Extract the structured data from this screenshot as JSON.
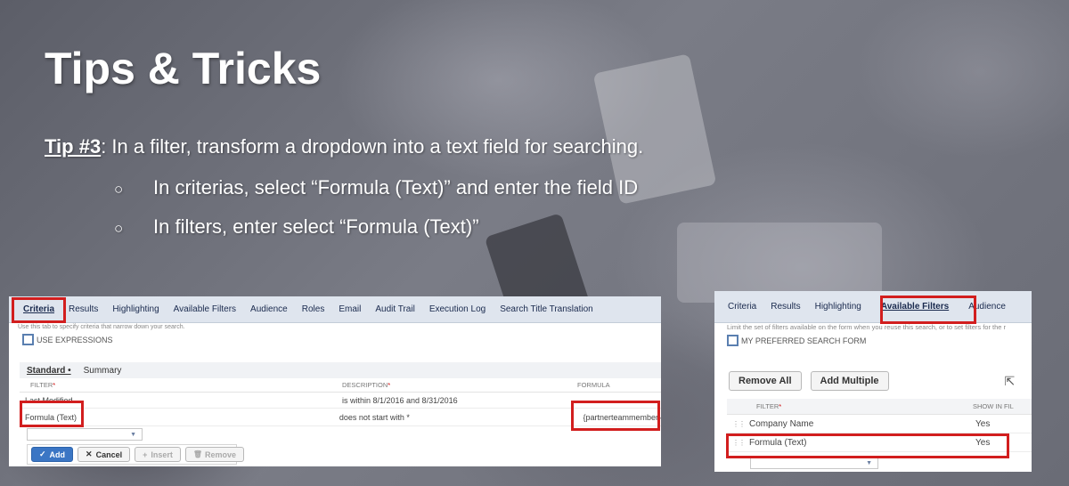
{
  "slide": {
    "title": "Tips & Tricks",
    "tip_label": "Tip #3",
    "tip_sep": ":",
    "tip_text": " In a filter, transform a dropdown into a text field for searching.",
    "bullet_glyph": "○",
    "bullets": [
      "In criterias, select “Formula (Text)” and enter the field ID",
      "In filters, enter select “Formula (Text)”"
    ]
  },
  "left_panel": {
    "tabs": [
      {
        "label": "Criteria"
      },
      {
        "label": "Results"
      },
      {
        "label": "Highlighting"
      },
      {
        "label": "Available Filters"
      },
      {
        "label": "Audience"
      },
      {
        "label": "Roles"
      },
      {
        "label": "Email"
      },
      {
        "label": "Audit Trail"
      },
      {
        "label": "Execution Log"
      },
      {
        "label": "Search Title Translation"
      }
    ],
    "hint": "Use this tab to specify criteria that narrow down your search.",
    "use_expressions": "USE EXPRESSIONS",
    "subtabs": {
      "standard": "Standard •",
      "summary": "Summary"
    },
    "columns": {
      "filter": "FILTER",
      "description": "DESCRIPTION",
      "formula": "FORMULA",
      "req": "*"
    },
    "rows": [
      {
        "filter": "Last Modified",
        "description": "is within 8/1/2016 and 8/31/2016",
        "formula": ""
      },
      {
        "filter": "Formula (Text)",
        "description": "does not start with *",
        "formula": "{partnerteammember}"
      }
    ],
    "dropdown_caret": "▼",
    "buttons": {
      "add": "Add",
      "cancel": "Cancel",
      "insert": "Insert",
      "remove": "Remove"
    },
    "icons": {
      "add": "✓",
      "cancel": "✕",
      "insert": "+",
      "remove": "🗑"
    }
  },
  "right_panel": {
    "tabs": [
      {
        "label": "Criteria"
      },
      {
        "label": "Results"
      },
      {
        "label": "Highlighting"
      },
      {
        "label": "Available Filters"
      },
      {
        "label": "Audience"
      }
    ],
    "hint": "Limit the set of filters available on the form when you reuse this search, or to set filters for the r",
    "preferred_form": "MY PREFERRED SEARCH FORM",
    "buttons": {
      "remove_all": "Remove All",
      "add_multiple": "Add Multiple"
    },
    "columns": {
      "filter": "FILTER",
      "show_in": "SHOW IN FIL",
      "req": "*"
    },
    "rows": [
      {
        "filter": "Company Name",
        "show": "Yes"
      },
      {
        "filter": "Formula (Text)",
        "show": "Yes"
      }
    ],
    "handle_glyph": "⋮⋮",
    "dropdown_caret": "▼",
    "cursor_glyph": "⇱"
  },
  "colors": {
    "highlight_box": "#d21e1e",
    "primary_button": "#3b76c4",
    "tab_text": "#1a2a4e"
  }
}
